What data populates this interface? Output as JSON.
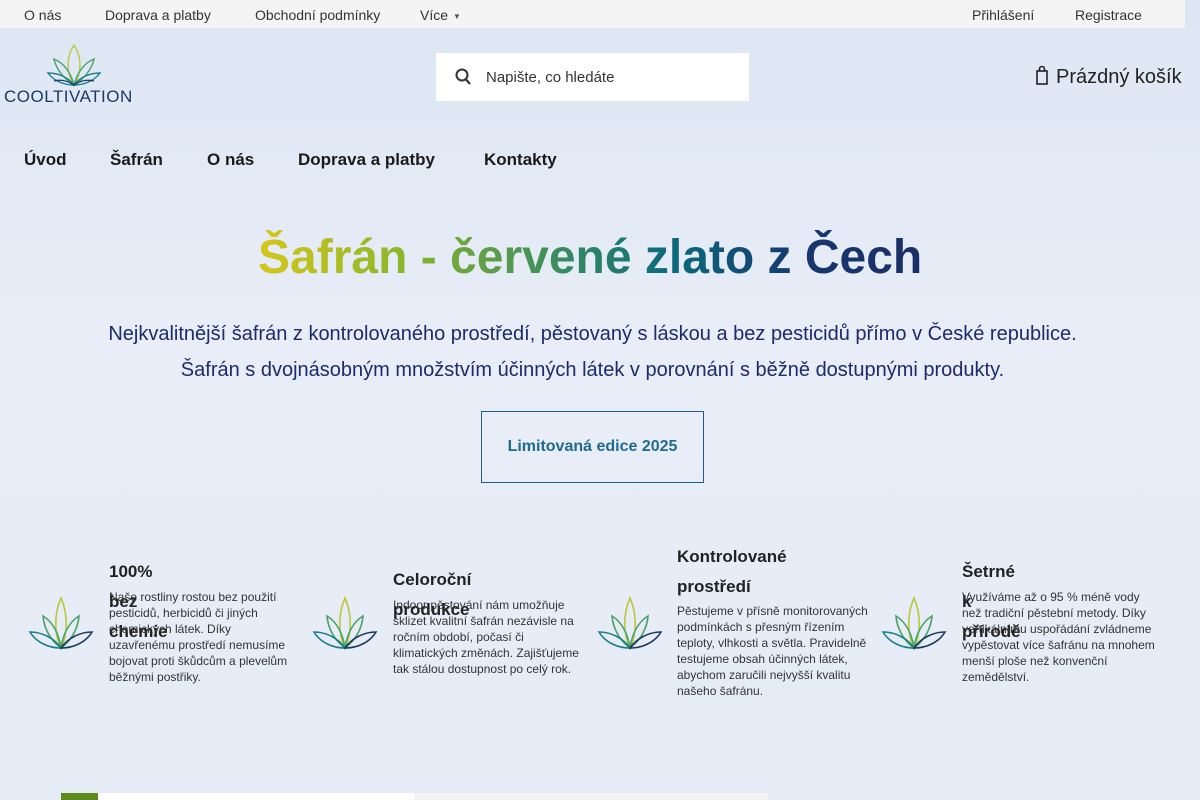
{
  "topbar": {
    "links": [
      "O nás",
      "Doprava a platby",
      "Obchodní podmínky",
      "Více"
    ],
    "login": "Přihlášení",
    "register": "Registrace"
  },
  "brand": {
    "name": "COOLTIVATION"
  },
  "search": {
    "placeholder": "Napište, co hledáte"
  },
  "cart": {
    "label": "Prázdný košík"
  },
  "nav": {
    "items": [
      "Úvod",
      "Šafrán",
      "O nás",
      "Doprava a platby",
      "Kontakty"
    ]
  },
  "hero": {
    "title": "Šafrán - červené zlato z Čech",
    "line1": "Nejkvalitnější šafrán z kontrolovaného prostředí, pěstovaný s láskou a bez pesticidů přímo v České republice.",
    "line2": "Šafrán s dvojnásobným množstvím účinných látek v porovnání s běžně dostupnými produkty.",
    "cta": "Limitovaná edice 2025"
  },
  "features": [
    {
      "title": "100% bez chemie",
      "text": "Naše rostliny rostou bez použití pesticidů, herbicidů či jiných chemických látek. Díky uzavřenému prostředí nemusíme bojovat proti škůdcům a plevelům běžnými postřiky."
    },
    {
      "title": "Celoroční produkce",
      "text": "Indoor pěstování nám umožňuje sklizet kvalitní šafrán nezávisle na ročním období, počasí či klimatických změnách. Zajišťujeme tak stálou dostupnost po celý rok."
    },
    {
      "title": "Kontrolované prostředí",
      "text": "Pěstujeme v přísně monitorovaných podmínkách s přesným řízením teploty, vlhkosti a světla. Pravidelně testujeme obsah účinných látek, abychom zaručili nejvyšší kvalitu našeho šafránu."
    },
    {
      "title": "Šetrné k přírodě",
      "text": "Využíváme až o 95 % méně vody než tradiční pěstební metody. Díky vertikálnímu uspořádání zvládneme vypěstovat více šafránu na mnohem menší ploše než konvenční zemědělství."
    }
  ],
  "colors": {
    "accent": "#1f6b8f",
    "navy": "#1d2a6b",
    "green": "#6fa63a",
    "yellow": "#d6c71a"
  }
}
